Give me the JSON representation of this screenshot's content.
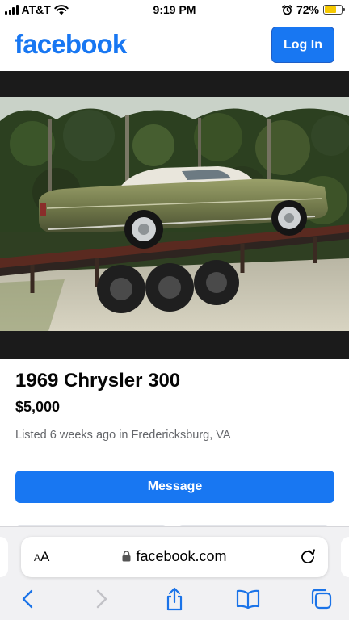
{
  "status_bar": {
    "carrier": "AT&T",
    "time": "9:19 PM",
    "battery_percent": "72%",
    "battery_level": 0.72,
    "icons": [
      "signal-bars-icon",
      "wifi-icon",
      "alarm-clock-icon",
      "battery-icon"
    ]
  },
  "header": {
    "logo_text": "facebook",
    "login_label": "Log In"
  },
  "listing": {
    "photo": "listing-photo",
    "title": "1969 Chrysler 300",
    "price": "$5,000",
    "listed_prefix": "Listed",
    "listed_time": "6 weeks ago",
    "listed_in": "in",
    "location": "Fredericksburg, VA",
    "message_label": "Message"
  },
  "browser": {
    "text_size_big": "A",
    "text_size_small": "A",
    "url": "facebook.com",
    "icons": [
      "lock-icon",
      "reload-icon",
      "back-icon",
      "forward-icon",
      "share-icon",
      "bookmarks-icon",
      "tabs-icon"
    ]
  },
  "colors": {
    "brand": "#1877f2",
    "text_primary": "#050505",
    "text_secondary": "#65676b",
    "battery": "#f6c900"
  }
}
